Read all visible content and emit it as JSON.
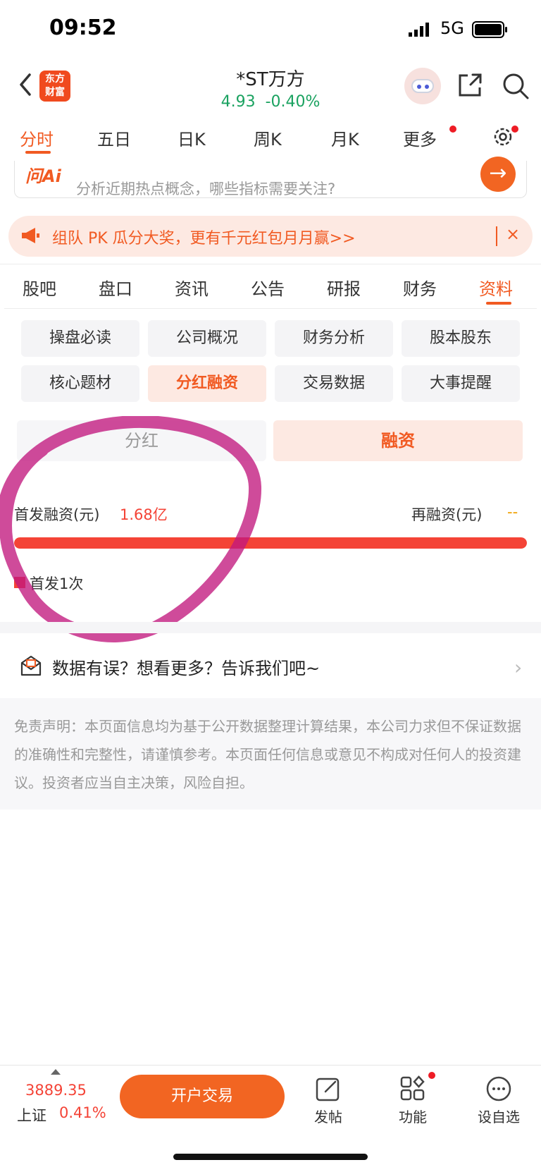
{
  "status_bar": {
    "time": "09:52",
    "network": "5G"
  },
  "header": {
    "logo_line1": "东方",
    "logo_line2": "财富",
    "stock_name": "*ST万方",
    "price": "4.93",
    "change": "-0.40%"
  },
  "chart_tabs": [
    "分时",
    "五日",
    "日K",
    "周K",
    "月K",
    "更多"
  ],
  "ai": {
    "logo": "问Ai",
    "hint": "分析近期热点概念，哪些指标需要关注?"
  },
  "promo": {
    "text": "组队 PK 瓜分大奖，更有千元红包月月赢>>",
    "close": "×"
  },
  "section_tabs": [
    "股吧",
    "盘口",
    "资讯",
    "公告",
    "研报",
    "财务",
    "资料"
  ],
  "sub_tabs": [
    "操盘必读",
    "公司概况",
    "财务分析",
    "股本股东",
    "核心题材",
    "分红融资",
    "交易数据",
    "大事提醒"
  ],
  "toggle": {
    "left": "分红",
    "right": "融资"
  },
  "financing": {
    "first_label": "首发融资(元)",
    "first_value": "1.68亿",
    "re_label": "再融资(元)",
    "re_value": "--",
    "first_share": 1.0,
    "legend": "首发1次"
  },
  "feedback": {
    "text": "数据有误？想看更多？告诉我们吧~",
    "chevron": "›"
  },
  "disclaimer": "免责声明：本页面信息均为基于公开数据整理计算结果，本公司力求但不保证数据的准确性和完整性，请谨慎参考。本页面任何信息或意见不构成对任何人的投资建议。投资者应当自主决策，风险自担。",
  "bottom": {
    "index_value": "3889.35",
    "index_name": "上证",
    "index_change": "0.41%",
    "open_account": "开户交易",
    "post": "发帖",
    "functions": "功能",
    "watchlist": "设自选"
  },
  "colors": {
    "accent": "#f15a22",
    "up": "#f44336",
    "down": "#1aa260"
  }
}
